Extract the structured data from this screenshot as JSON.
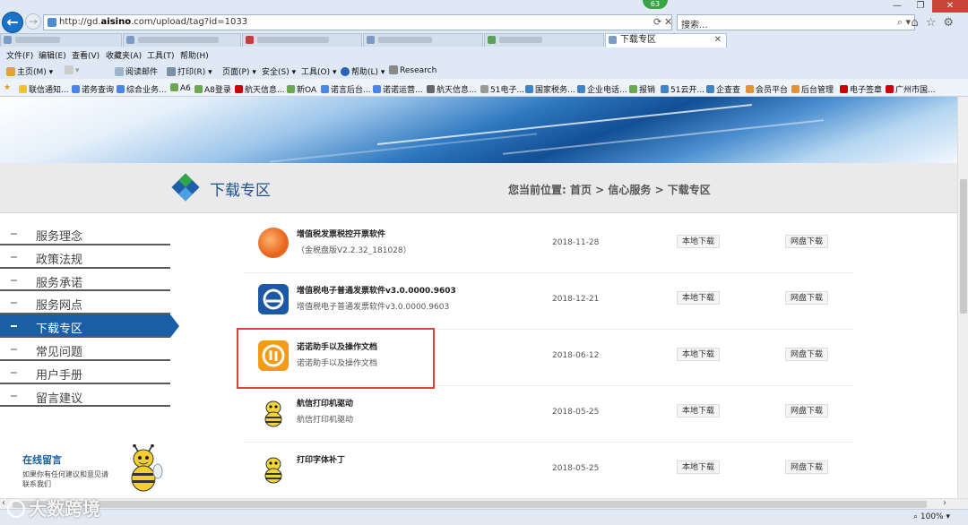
{
  "browser": {
    "url_prefix": "http://gd.",
    "url_bold": "aisino",
    "url_suffix": ".com/upload/tag?id=1033",
    "badge": "63",
    "search_placeholder": "搜索...",
    "active_tab": "下载专区",
    "menu": [
      "文件(F)",
      "编辑(E)",
      "查看(V)",
      "收藏夹(A)",
      "工具(T)",
      "帮助(H)"
    ],
    "commands": {
      "home": "主页(M)",
      "read_mail": "阅读邮件",
      "print": "打印(R)",
      "page": "页面(P)",
      "safety": "安全(S)",
      "tools": "工具(O)",
      "help": "帮助(L)",
      "research": "Research"
    },
    "favorites": [
      "联信通知...",
      "诺务查询",
      "综合业务...",
      "A6",
      "A8登录",
      "航天信息...",
      "新OA",
      "诺言后台...",
      "诺诺运营...",
      "航天信息...",
      "51电子...",
      "国家税务...",
      "企业电话...",
      "报销",
      "51云开...",
      "企查查",
      "会员平台",
      "后台管理",
      "电子签章",
      "广州市国..."
    ],
    "zoom": "100%"
  },
  "page": {
    "heading": "下载专区",
    "breadcrumb": "您当前位置: 首页 > 信心服务 > 下载专区",
    "sidebar": [
      {
        "label": "服务理念",
        "active": false
      },
      {
        "label": "政策法规",
        "active": false
      },
      {
        "label": "服务承诺",
        "active": false
      },
      {
        "label": "服务网点",
        "active": false
      },
      {
        "label": "下载专区",
        "active": true
      },
      {
        "label": "常见问题",
        "active": false
      },
      {
        "label": "用户手册",
        "active": false
      },
      {
        "label": "留言建议",
        "active": false
      }
    ],
    "online_msg": {
      "title": "在线留言",
      "desc": "如果你有任何建议和意见请联系我们"
    },
    "downloads": [
      {
        "title": "增值税发票税控开票软件",
        "subtitle": "（金税盘版V2.2.32_181028）",
        "date": "2018-11-28",
        "local": "本地下载",
        "cloud": "网盘下载",
        "icon_color": "#e8651d"
      },
      {
        "title": "增值税电子普通发票软件v3.0.0000.9603",
        "subtitle": "增值税电子普通发票软件v3.0.0000.9603",
        "date": "2018-12-21",
        "local": "本地下载",
        "cloud": "网盘下载",
        "icon_color": "#1d58a6"
      },
      {
        "title": "诺诺助手以及操作文档",
        "subtitle": "诺诺助手以及操作文档",
        "date": "2018-06-12",
        "local": "本地下载",
        "cloud": "网盘下载",
        "icon_color": "#f39a17"
      },
      {
        "title": "航信打印机驱动",
        "subtitle": "航信打印机驱动",
        "date": "2018-05-25",
        "local": "本地下载",
        "cloud": "网盘下载",
        "icon_color": "#f2d43a"
      },
      {
        "title": "打印字体补丁",
        "subtitle": "",
        "date": "2018-05-25",
        "local": "本地下载",
        "cloud": "网盘下载",
        "icon_color": "#f2d43a"
      }
    ],
    "highlight_color": "#d8453d"
  },
  "watermark": "大数跨境"
}
